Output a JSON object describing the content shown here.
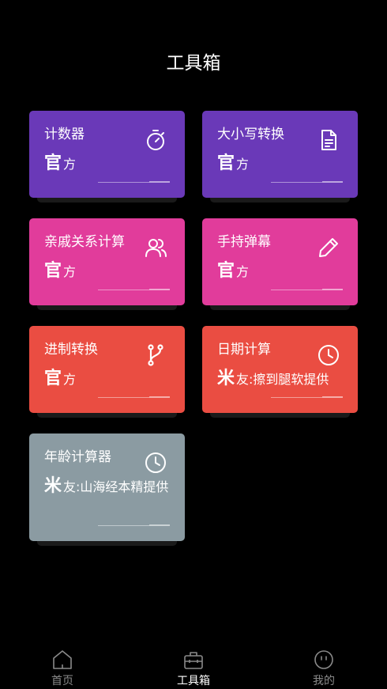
{
  "header": {
    "title": "工具箱"
  },
  "cards": [
    {
      "name": "计数器",
      "source_mark": "官",
      "source_text": "方",
      "icon": "stopwatch-icon"
    },
    {
      "name": "大小写转换",
      "source_mark": "官",
      "source_text": "方",
      "icon": "document-icon"
    },
    {
      "name": "亲戚关系计算",
      "source_mark": "官",
      "source_text": "方",
      "icon": "users-icon"
    },
    {
      "name": "手持弹幕",
      "source_mark": "官",
      "source_text": "方",
      "icon": "pencil-icon"
    },
    {
      "name": "进制转换",
      "source_mark": "官",
      "source_text": "方",
      "icon": "git-branch-icon"
    },
    {
      "name": "日期计算",
      "source_mark": "米",
      "source_text": "友:擦到腿软提供",
      "icon": "clock-icon"
    },
    {
      "name": "年龄计算器",
      "source_mark": "米",
      "source_text": "友:山海经本精提供",
      "icon": "clock-icon"
    }
  ],
  "colors": {
    "purple": "#6a39b8",
    "pink": "#e13c9b",
    "red": "#ea4d42",
    "grey": "#8b9ba2"
  },
  "tabbar": {
    "items": [
      {
        "label": "首页",
        "icon": "home-icon"
      },
      {
        "label": "工具箱",
        "icon": "toolbox-icon",
        "active": true
      },
      {
        "label": "我的",
        "icon": "face-icon"
      }
    ]
  }
}
